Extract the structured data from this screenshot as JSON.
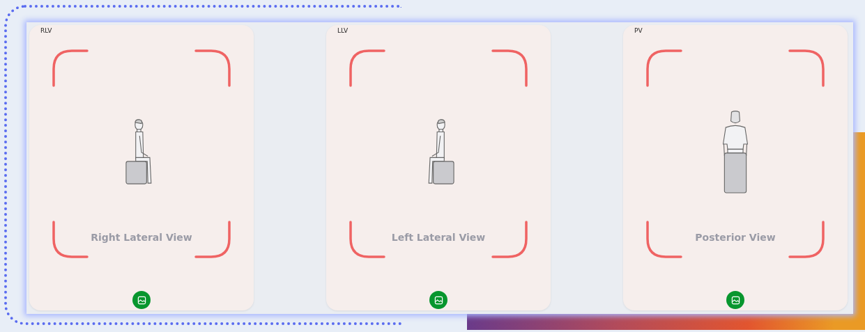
{
  "views": [
    {
      "code": "RLV",
      "label": "Right Lateral View",
      "kind": "side-right"
    },
    {
      "code": "LLV",
      "label": "Left Lateral View",
      "kind": "side-left"
    },
    {
      "code": "PV",
      "label": "Posterior View",
      "kind": "back"
    }
  ]
}
